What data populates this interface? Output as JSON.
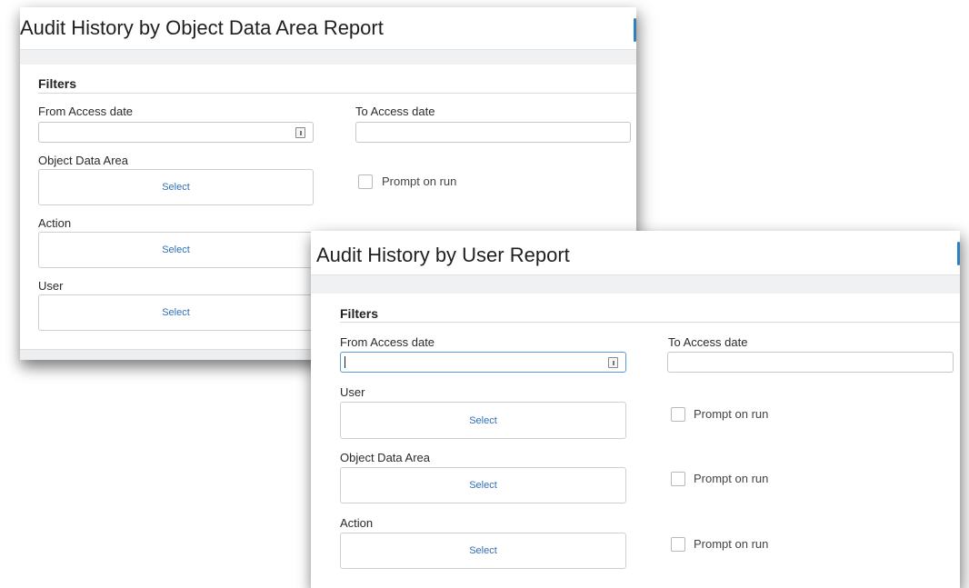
{
  "panel1": {
    "title": "Audit History by Object Data Area Report",
    "filters_label": "Filters",
    "from_date_label": "From Access date",
    "to_date_label": "To Access date",
    "object_data_area_label": "Object Data Area",
    "object_data_area_select": "Select",
    "prompt_on_run_label": "Prompt on run",
    "action_label": "Action",
    "action_select": "Select",
    "user_label": "User",
    "user_select": "Select"
  },
  "panel2": {
    "title": "Audit History by User Report",
    "filters_label": "Filters",
    "from_date_label": "From Access date",
    "to_date_label": "To Access date",
    "user_label": "User",
    "user_select": "Select",
    "user_prompt_label": "Prompt on run",
    "object_data_area_label": "Object Data Area",
    "object_data_area_select": "Select",
    "object_data_area_prompt_label": "Prompt on run",
    "action_label": "Action",
    "action_select": "Select",
    "action_prompt_label": "Prompt on run"
  },
  "colors": {
    "link_blue": "#2f6fb5",
    "accent_blue": "#2f7fc1",
    "strip_grey": "#f0f1f2"
  },
  "icons": {
    "date_picker": "calendar-icon"
  }
}
